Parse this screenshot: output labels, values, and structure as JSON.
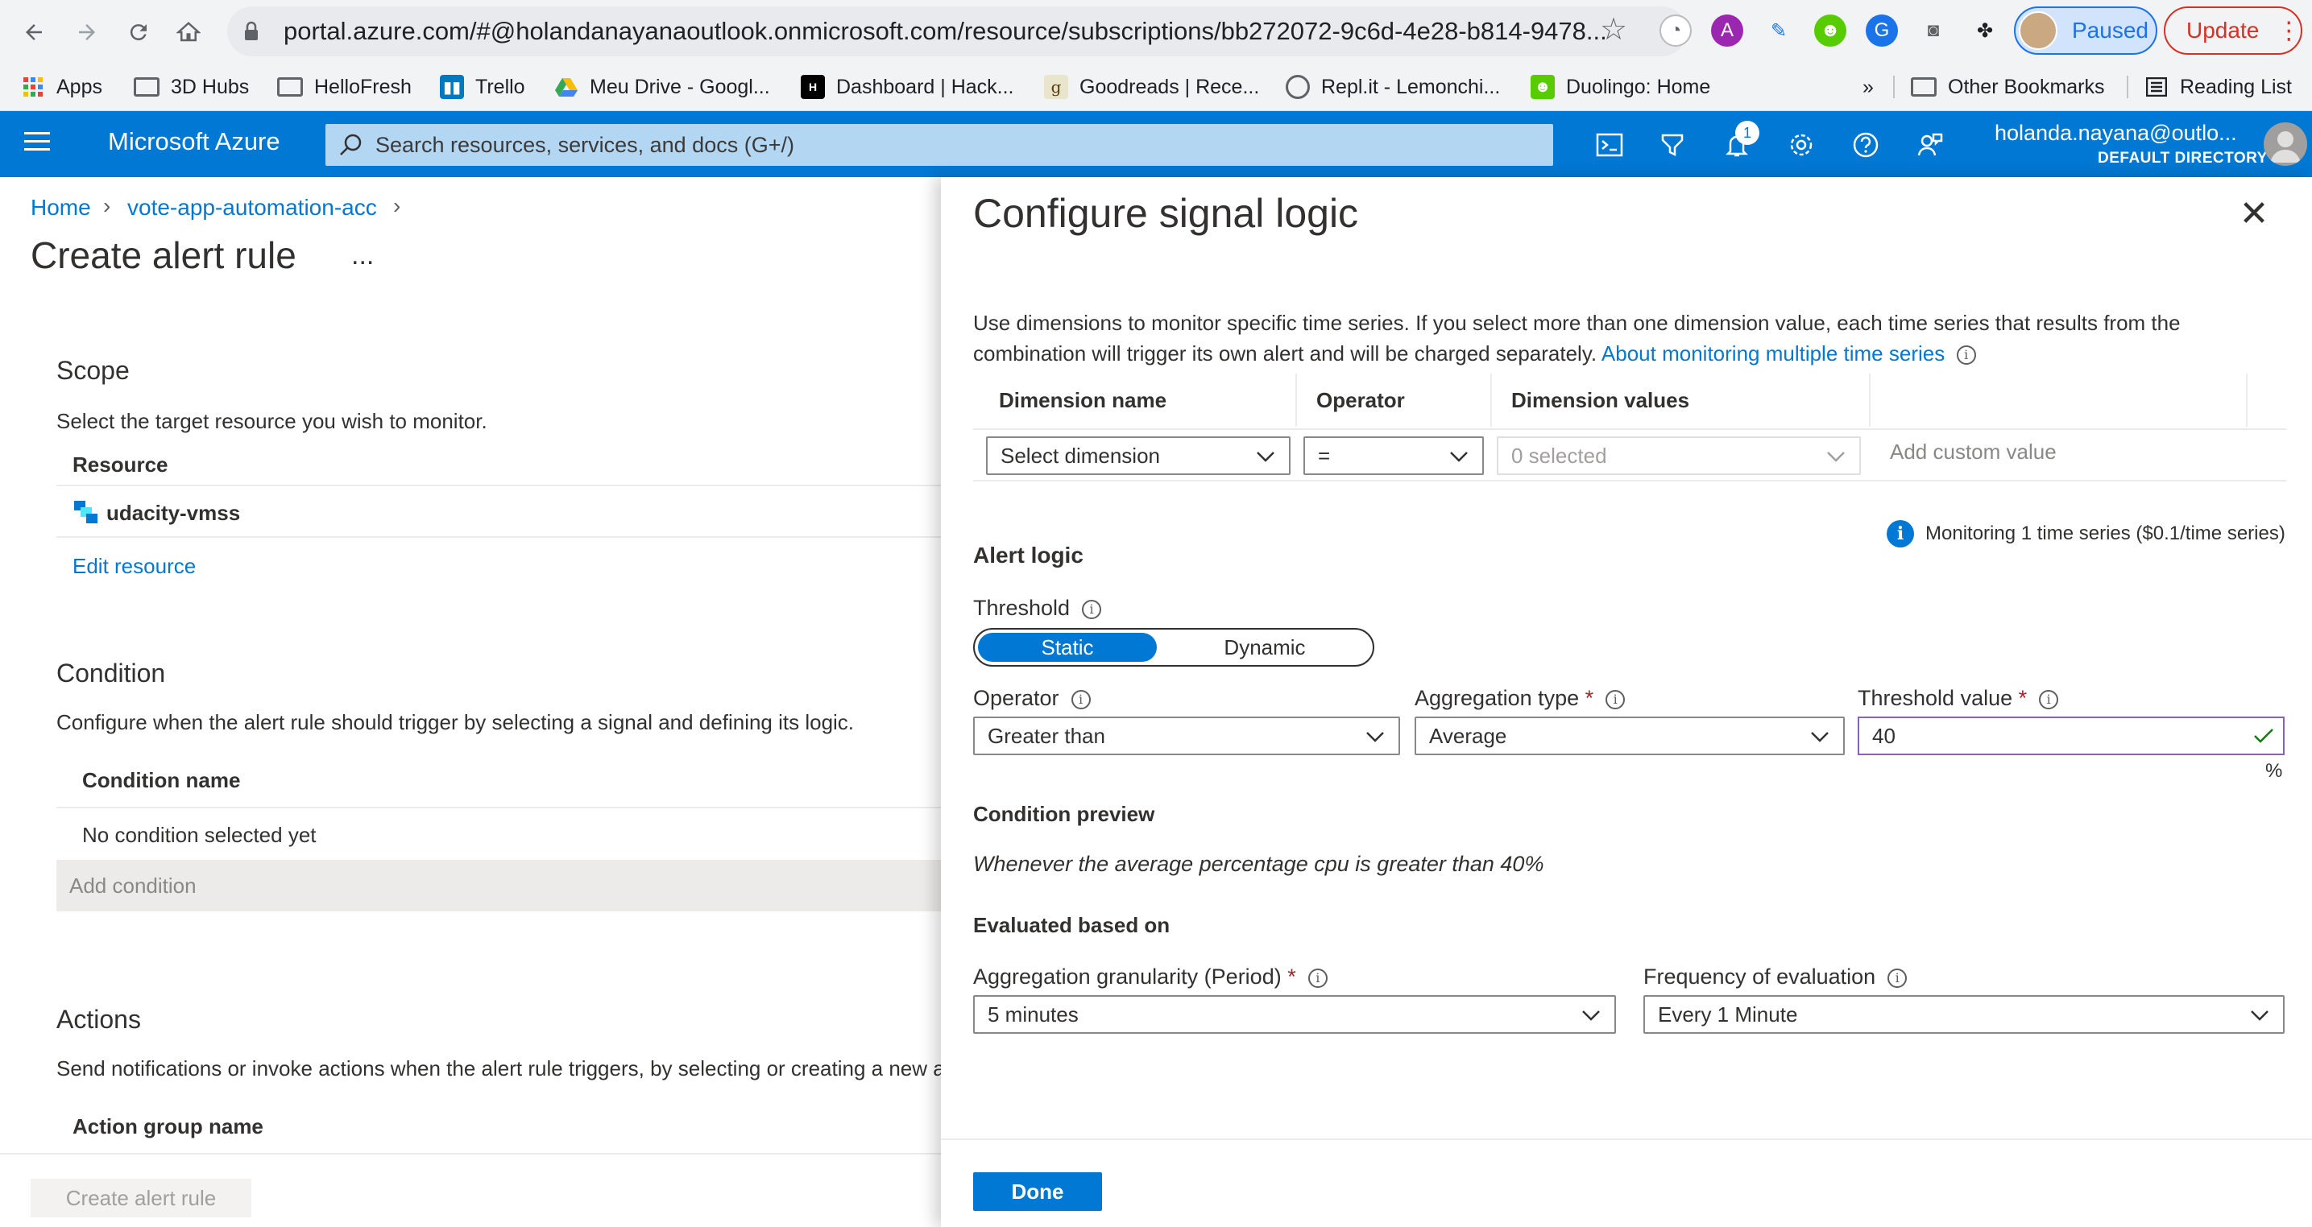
{
  "browser": {
    "url": "portal.azure.com/#@holandanayanaoutlook.onmicrosoft.com/resource/subscriptions/bb272072-9c6d-4e28-b814-9478...",
    "paused_label": "Paused",
    "update_label": "Update",
    "bookmarks": [
      "Apps",
      "3D Hubs",
      "HelloFresh",
      "Trello",
      "Meu Drive - Googl...",
      "Dashboard | Hack...",
      "Goodreads | Rece...",
      "Repl.it - Lemonchi...",
      "Duolingo: Home"
    ],
    "overflow": "»",
    "other_bookmarks": "Other Bookmarks",
    "reading_list": "Reading List"
  },
  "azure": {
    "brand": "Microsoft Azure",
    "search_placeholder": "Search resources, services, and docs (G+/)",
    "notification_count": "1",
    "user_email": "holanda.nayana@outlo...",
    "user_directory": "DEFAULT DIRECTORY"
  },
  "left": {
    "breadcrumb": [
      "Home",
      "vote-app-automation-acc"
    ],
    "title": "Create alert rule",
    "more": "...",
    "scope": {
      "heading": "Scope",
      "description": "Select the target resource you wish to monitor.",
      "column": "Resource",
      "resource": "udacity-vmss",
      "edit_link": "Edit resource"
    },
    "condition": {
      "heading": "Condition",
      "description": "Configure when the alert rule should trigger by selecting a signal and defining its logic.",
      "column": "Condition name",
      "empty": "No condition selected yet",
      "add": "Add condition"
    },
    "actions": {
      "heading": "Actions",
      "description": "Send notifications or invoke actions when the alert rule triggers, by selecting or creating a new a",
      "column": "Action group name"
    },
    "create_button": "Create alert rule"
  },
  "panel": {
    "title": "Configure signal logic",
    "description": "Use dimensions to monitor specific time series. If you select more than one dimension value, each time series that results from the combination will trigger its own alert and will be charged separately.",
    "description_link": "About monitoring multiple time series",
    "dimensions": {
      "headers": [
        "Dimension name",
        "Operator",
        "Dimension values"
      ],
      "dimension_select": "Select dimension",
      "operator_select": "=",
      "values_select": "0 selected",
      "custom_value_placeholder": "Add custom value"
    },
    "monitoring_note": "Monitoring 1 time series ($0.1/time series)",
    "alert_logic": {
      "heading": "Alert logic",
      "threshold_label": "Threshold",
      "threshold_options": [
        "Static",
        "Dynamic"
      ],
      "operator_label": "Operator",
      "operator_value": "Greater than",
      "aggregation_label": "Aggregation type",
      "aggregation_value": "Average",
      "threshold_value_label": "Threshold value",
      "threshold_value": "40",
      "unit": "%"
    },
    "preview": {
      "heading": "Condition preview",
      "text": "Whenever the average percentage cpu is greater than 40%"
    },
    "evaluation": {
      "heading": "Evaluated based on",
      "granularity_label": "Aggregation granularity (Period)",
      "granularity_value": "5 minutes",
      "frequency_label": "Frequency of evaluation",
      "frequency_value": "Every 1 Minute"
    },
    "done_button": "Done"
  }
}
